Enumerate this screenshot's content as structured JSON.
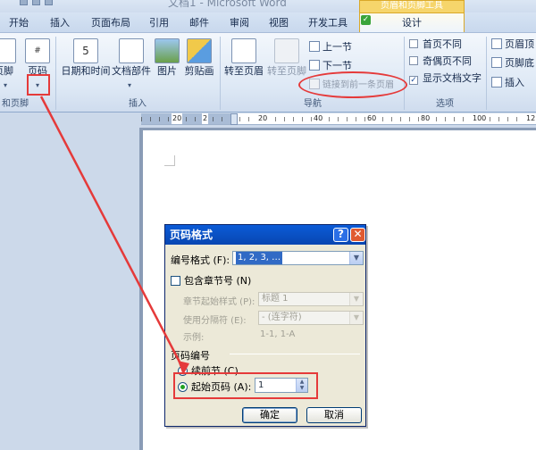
{
  "window": {
    "title": "文档1 - Microsoft Word"
  },
  "tabs": [
    {
      "label": "开始"
    },
    {
      "label": "插入"
    },
    {
      "label": "页面布局"
    },
    {
      "label": "引用"
    },
    {
      "label": "邮件"
    },
    {
      "label": "审阅"
    },
    {
      "label": "视图"
    },
    {
      "label": "开发工具"
    }
  ],
  "contextual_tab": {
    "group": "页眉和页脚工具",
    "label": "设计"
  },
  "ribbon": {
    "header_footer": {
      "footer_label": "页脚",
      "page_number_label": "页码",
      "group_label": "和页脚",
      "dropdown": "▾"
    },
    "insert": {
      "date_time": "日期和时间",
      "doc_parts": "文档部件",
      "picture": "图片",
      "clip_art": "剪贴画",
      "group_label": "插入"
    },
    "navigation": {
      "goto_header": "转至页眉",
      "goto_footer": "转至页脚",
      "prev_section": "上一节",
      "next_section": "下一节",
      "link_previous": "链接到前一条页眉",
      "group_label": "导航"
    },
    "options": {
      "different_first": "首页不同",
      "different_odd_even": "奇偶页不同",
      "show_doc_text": "显示文档文字",
      "show_doc_text_checked": true,
      "group_label": "选项"
    },
    "position": {
      "header_top": "页眉顶",
      "footer_bottom": "页脚底",
      "insert": "插入"
    }
  },
  "ruler": {
    "marks": [
      "20",
      "2",
      "20",
      "40",
      "60",
      "80",
      "100",
      "12"
    ]
  },
  "dialog": {
    "title": "页码格式",
    "help": "?",
    "close": "✕",
    "number_format_label": "编号格式 (F):",
    "number_format_value": "1, 2, 3, …",
    "include_chapter": "包含章节号 (N)",
    "chapter_style_label": "章节起始样式 (P):",
    "chapter_style_value": "标题 1",
    "separator_label": "使用分隔符 (E):",
    "separator_value": "-   (连字符)",
    "example_label": "示例:",
    "example_value": "1-1, 1-A",
    "numbering_section": "页码编号",
    "continue_label": "续前节 (C)",
    "start_at_label": "起始页码 (A):",
    "start_at_value": "1",
    "ok": "确定",
    "cancel": "取消"
  }
}
